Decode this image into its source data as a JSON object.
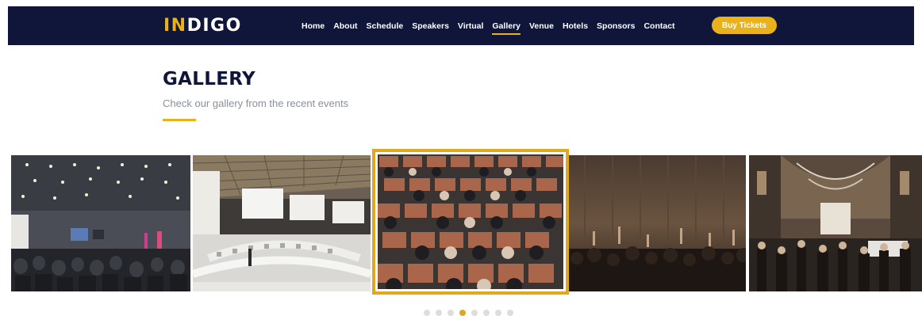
{
  "header": {
    "logo_part1": "IN",
    "logo_part2": "DIGO",
    "nav": [
      {
        "label": "Home"
      },
      {
        "label": "About"
      },
      {
        "label": "Schedule"
      },
      {
        "label": "Speakers"
      },
      {
        "label": "Virtual"
      },
      {
        "label": "Gallery",
        "active": true
      },
      {
        "label": "Venue"
      },
      {
        "label": "Hotels"
      },
      {
        "label": "Sponsors"
      },
      {
        "label": "Contact"
      }
    ],
    "buy_label": "Buy Tickets"
  },
  "section": {
    "title": "GALLERY",
    "subtitle": "Check our gallery from the recent events"
  },
  "gallery": {
    "photos": [
      "conference-hall-photo",
      "auditorium-screens-photo",
      "audience-seats-photo",
      "concert-crowd-photo",
      "exhibition-hall-photo"
    ],
    "active_index": 2
  },
  "pagination": {
    "dot_count": 8,
    "active_index": 3
  },
  "colors": {
    "navy": "#0f1639",
    "accent": "#eab21a",
    "muted": "#8a8f99"
  }
}
